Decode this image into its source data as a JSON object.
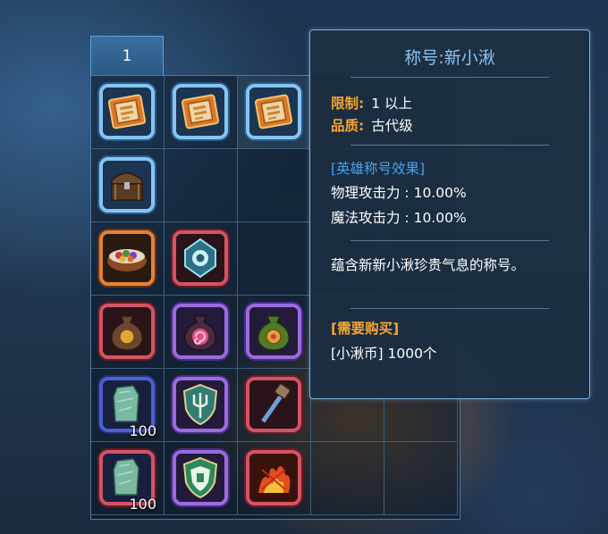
{
  "inventory": {
    "tab_label": "1",
    "rows": [
      [
        {
          "icon": "title-card-icon",
          "frame": "blue",
          "qty": ""
        },
        {
          "icon": "title-card-icon",
          "frame": "blue",
          "qty": ""
        },
        {
          "icon": "title-card-icon",
          "frame": "blue",
          "qty": "",
          "selected": true
        },
        null,
        null
      ],
      [
        {
          "icon": "treasure-chest-icon",
          "frame": "blue",
          "qty": ""
        },
        null,
        null,
        null,
        null
      ],
      [
        {
          "icon": "candy-bowl-icon",
          "frame": "orange",
          "qty": ""
        },
        {
          "icon": "eye-card-icon",
          "frame": "red",
          "qty": ""
        },
        null,
        null,
        null
      ],
      [
        {
          "icon": "coin-pouch-icon",
          "frame": "red",
          "qty": ""
        },
        {
          "icon": "spiral-pouch-icon",
          "frame": "purple",
          "qty": ""
        },
        {
          "icon": "green-pouch-icon",
          "frame": "purple",
          "qty": ""
        },
        null,
        null
      ],
      [
        {
          "icon": "jade-stone-icon",
          "frame": "navy",
          "qty": "100"
        },
        {
          "icon": "trident-shield-icon",
          "frame": "purple",
          "qty": ""
        },
        {
          "icon": "hammer-icon",
          "frame": "red",
          "qty": ""
        },
        null,
        null
      ],
      [
        {
          "icon": "jade-stone-icon",
          "frame": "red",
          "qty": "100"
        },
        {
          "icon": "green-shield-icon",
          "frame": "purple",
          "qty": ""
        },
        {
          "icon": "fire-rune-icon",
          "frame": "red",
          "qty": ""
        },
        null,
        null
      ]
    ]
  },
  "tooltip": {
    "title": "称号:新小湫",
    "restriction_label": "限制:",
    "restriction_value": "1 以上",
    "quality_label": "品质:",
    "quality_value": "古代级",
    "effect_header": "[英雄称号效果]",
    "effects": [
      "物理攻击力 : 10.00%",
      "魔法攻击力 : 10.00%"
    ],
    "description": "蕴含新新小湫珍贵气息的称号。",
    "purchase_header": "[需要购买]",
    "purchase_cost": "[小湫币] 1000个"
  },
  "colors": {
    "label_orange": "#f7a531",
    "header_blue": "#4aa3ea",
    "title_blue": "#8cc2f0"
  }
}
